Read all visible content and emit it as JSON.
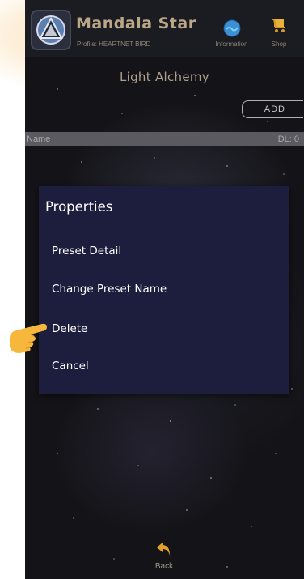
{
  "app": {
    "title": "Mandala Star",
    "profile": "Profile: HEARTNET BIRD"
  },
  "header": {
    "information_label": "Information",
    "shop_label": "Shop"
  },
  "screen": {
    "title": "Light Alchemy",
    "add_label": "ADD"
  },
  "list": {
    "name_header": "Name",
    "dl_header": "DL: 0"
  },
  "dialog": {
    "title": "Properties",
    "options": [
      "Preset Detail",
      "Change Preset Name",
      "Delete",
      "Cancel"
    ]
  },
  "footer": {
    "back_label": "Back"
  },
  "colors": {
    "dialog_bg": "#1d1d3d",
    "title_gold": "#b9a788",
    "background": "#141418"
  },
  "icons": {
    "logo": "mandala-star-logo-icon",
    "information": "globe-icon",
    "shop": "shopping-cart-icon",
    "back": "back-arrow-icon",
    "pointer": "pointing-hand-icon"
  }
}
